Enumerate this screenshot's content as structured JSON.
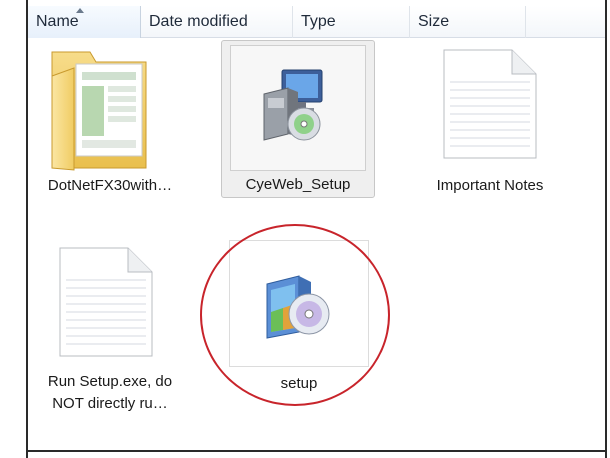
{
  "columns": {
    "name": "Name",
    "date_modified": "Date modified",
    "type": "Type",
    "size": "Size"
  },
  "files": [
    {
      "label": "DotNetFX30with…",
      "icon": "folder-icon"
    },
    {
      "label": "CyeWeb_Setup",
      "icon": "installer-icon",
      "selected": true
    },
    {
      "label": "Important Notes",
      "icon": "text-document-icon"
    },
    {
      "label_line1": "Run Setup.exe, do",
      "label_line2": "NOT directly ru…",
      "icon": "text-document-icon"
    },
    {
      "label": "setup",
      "icon": "setup-cd-icon",
      "highlighted": true
    }
  ],
  "colors": {
    "highlight_circle": "#c8242b",
    "selection_bg": "#efefef"
  }
}
